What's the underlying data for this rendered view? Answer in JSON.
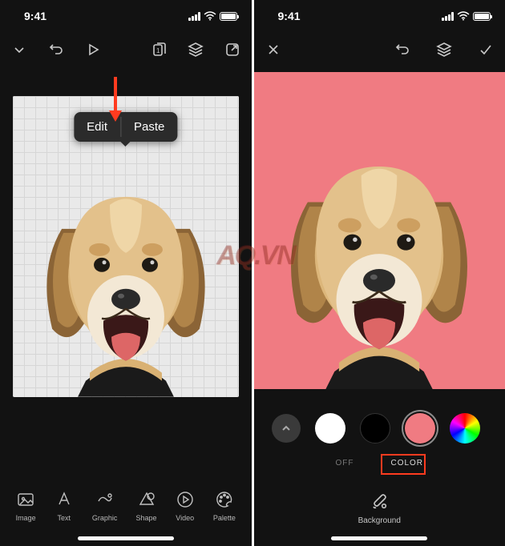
{
  "status": {
    "time": "9:41"
  },
  "left_screen": {
    "popup": {
      "edit": "Edit",
      "paste": "Paste"
    },
    "tools": [
      {
        "label": "Image"
      },
      {
        "label": "Text"
      },
      {
        "label": "Graphic"
      },
      {
        "label": "Shape"
      },
      {
        "label": "Video"
      },
      {
        "label": "Palette"
      }
    ]
  },
  "right_screen": {
    "color_tabs": {
      "off": "OFF",
      "color": "COLOR"
    },
    "selected_color": "#f07b82",
    "colors": {
      "white": "#ffffff",
      "black": "#000000",
      "pink": "#f07b82"
    },
    "background_label": "Background"
  },
  "watermark": "AQ.VN"
}
